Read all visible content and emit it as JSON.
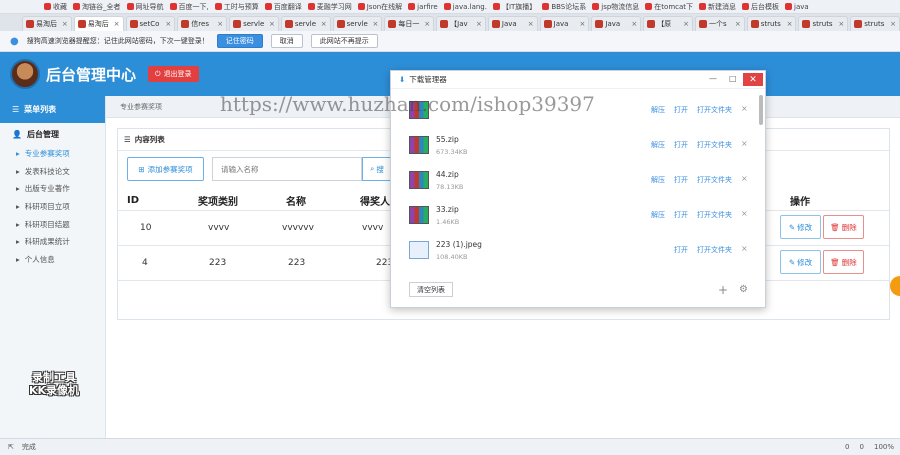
{
  "browser": {
    "bookmarks": [
      "收藏",
      "淘链谷_全者",
      "网址导航",
      "百度一下,",
      "工时与预算",
      "百度翻译",
      "麦融学习网",
      "Json在线解",
      "jarfire",
      "java.lang.",
      "【IT旗播】",
      "BBS论坛系",
      "jsp物流信息",
      "在tomcat下",
      "新建消息",
      "后台模板",
      "java"
    ],
    "tabs": [
      "易淘后",
      "易淘后",
      "setCo",
      "信res",
      "servle",
      "servle",
      "servle",
      "每日一",
      "【Jav",
      "Java",
      "Java",
      "Java",
      "【原",
      "一个s",
      "struts",
      "struts",
      "struts"
    ],
    "password_bar": {
      "message": "搜狗高速浏览器提醒您：记住此网站密码，下次一键登录！",
      "remember": "记住密码",
      "cancel": "取消",
      "never": "此网站不再提示"
    }
  },
  "app": {
    "title": "后台管理中心",
    "logout": "退出登录"
  },
  "sidebar": {
    "menu_title": "菜单列表",
    "group": "后台管理",
    "items": [
      "专业参赛奖项",
      "发表科技论文",
      "出版专业著作",
      "科研项目立项",
      "科研项目结题",
      "科研成果统计",
      "个人信息"
    ]
  },
  "watermark": {
    "line1": "录制工具",
    "line2": "KK录像机"
  },
  "breadcrumb": "专业参赛奖项",
  "panel": {
    "title": "内容列表",
    "add_button": "添加参赛奖项",
    "search_placeholder": "请输入名称",
    "search_button": "搜",
    "columns": [
      "ID",
      "奖项类别",
      "名称",
      "得奖人",
      "操作"
    ],
    "rows": [
      {
        "id": "10",
        "category": "vvvv",
        "name": "vvvvvv",
        "winner": "vvvv"
      },
      {
        "id": "4",
        "category": "223",
        "name": "223",
        "winner": "223"
      }
    ],
    "edit": "修改",
    "delete": "删除"
  },
  "download_manager": {
    "title": "下载管理器",
    "items": [
      {
        "name": "",
        "size": "",
        "type": "zip"
      },
      {
        "name": "55.zip",
        "size": "673.34KB",
        "type": "zip"
      },
      {
        "name": "44.zip",
        "size": "78.13KB",
        "type": "zip"
      },
      {
        "name": "33.zip",
        "size": "1.46KB",
        "type": "zip"
      },
      {
        "name": "223 (1).jpeg",
        "size": "108.40KB",
        "type": "image"
      }
    ],
    "unzip": "解压",
    "open": "打开",
    "open_folder": "打开文件夹",
    "clear": "清空列表"
  },
  "overlay_text": "https://www.huzhan.com/ishop39397",
  "status": {
    "left": "完成",
    "zoom": "100%",
    "count1": "0",
    "count2": "0"
  },
  "colors": {
    "primary": "#2d8ed8",
    "danger": "#e24040"
  }
}
